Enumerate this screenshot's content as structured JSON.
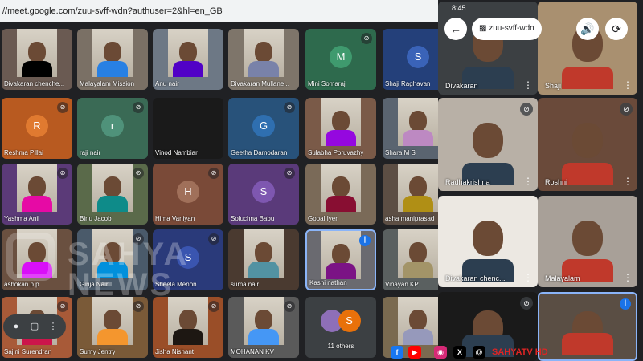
{
  "browser": {
    "url": "//meet.google.com/zuu-svff-wdn?authuser=2&hl=en_GB"
  },
  "grid": {
    "participants": [
      {
        "name": "Divakaran chenche...",
        "kind": "photo",
        "bg": "#6a5a52",
        "mic_off": false
      },
      {
        "name": "Malayalam Mission",
        "kind": "photo",
        "bg": "#7a7065",
        "mic_off": false
      },
      {
        "name": "Anu nair",
        "kind": "photo",
        "bg": "#6d7885",
        "mic_off": false
      },
      {
        "name": "Divakaran Mullane...",
        "kind": "photo",
        "bg": "#7e756a",
        "mic_off": false
      },
      {
        "name": "Mini Somaraj",
        "kind": "avatar",
        "letter": "M",
        "bg": "#2e6a4d",
        "avatar": "#3f9a6e",
        "mic_off": true
      },
      {
        "name": "Shaji Raghavan",
        "kind": "avatar",
        "letter": "S",
        "bg": "#24407a",
        "avatar": "#3a63b8",
        "mic_off": true
      },
      {
        "name": "Reshma Pillai",
        "kind": "avatar",
        "letter": "R",
        "bg": "#b85a20",
        "avatar": "#e07a30",
        "mic_off": true
      },
      {
        "name": "raji nair",
        "kind": "avatar",
        "letter": "r",
        "bg": "#3a6a55",
        "avatar": "#4f927a",
        "mic_off": true
      },
      {
        "name": "Vinod Nambiar",
        "kind": "dark",
        "bg": "#1a1a1a",
        "mic_off": false
      },
      {
        "name": "Geetha Damodaran",
        "kind": "avatar",
        "letter": "G",
        "bg": "#28527a",
        "avatar": "#2f6fb0",
        "mic_off": true
      },
      {
        "name": "Sulabha Poruvazhy",
        "kind": "photo",
        "bg": "#7a5a48",
        "mic_off": false
      },
      {
        "name": "Shara M S",
        "kind": "photo",
        "bg": "#5a6470",
        "mic_off": false
      },
      {
        "name": "Yashma Anil",
        "kind": "photo",
        "bg": "#5b3a78",
        "mic_off": true
      },
      {
        "name": "Binu Jacob",
        "kind": "photo",
        "bg": "#5a6a4a",
        "mic_off": true
      },
      {
        "name": "Hima Vaniyan",
        "kind": "avatar",
        "letter": "H",
        "bg": "#7a4a38",
        "avatar": "#a0705a",
        "mic_off": true
      },
      {
        "name": "Soluchna Babu",
        "kind": "avatar",
        "letter": "S",
        "bg": "#5a3a7a",
        "avatar": "#7e57b0",
        "mic_off": true
      },
      {
        "name": "Gopal Iyer",
        "kind": "photo",
        "bg": "#7a6a58",
        "mic_off": false
      },
      {
        "name": "asha maniprasad",
        "kind": "photo",
        "bg": "#5c4e44",
        "mic_off": false
      },
      {
        "name": "ashokan p p",
        "kind": "photo",
        "bg": "#6a5040",
        "mic_off": false
      },
      {
        "name": "Girija Nair",
        "kind": "photo",
        "bg": "#4a5a6a",
        "mic_off": true
      },
      {
        "name": "Sheela Menon",
        "kind": "avatar",
        "letter": "S",
        "bg": "#2a3a7a",
        "avatar": "#3a55b0",
        "mic_off": true
      },
      {
        "name": "suma nair",
        "kind": "photo",
        "bg": "#4a3a30",
        "mic_off": false
      },
      {
        "name": "Kashi nathan",
        "kind": "photo",
        "bg": "#6a6a70",
        "mic_off": false,
        "speaking": true
      },
      {
        "name": "Vinayan KP",
        "kind": "photo",
        "bg": "#5a6060",
        "mic_off": false
      },
      {
        "name": "Sajini Surendran",
        "kind": "photo",
        "bg": "#a85a38",
        "mic_off": true
      },
      {
        "name": "Sumy Jentry",
        "kind": "photo",
        "bg": "#7a5a38",
        "mic_off": true
      },
      {
        "name": "Jisha Nishant",
        "kind": "photo",
        "bg": "#9a4e28",
        "mic_off": true
      },
      {
        "name": "MOHANAN KV",
        "kind": "photo",
        "bg": "#5a5a5a",
        "mic_off": true
      },
      {
        "name": "11 others",
        "kind": "others",
        "bg": "#3c4043",
        "mic_off": false
      },
      {
        "name": "",
        "kind": "photo",
        "bg": "#7a6a50",
        "mic_off": false
      }
    ]
  },
  "watermark": {
    "line1": "SAHYA",
    "line2": "NEWS"
  },
  "phone": {
    "time": "8:45",
    "room": "zuu-svff-wdn",
    "tiles": [
      {
        "name": "Divakaran",
        "bg": "#3c4043",
        "mic_off": false
      },
      {
        "name": "Shaji",
        "bg": "#a99070",
        "mic_off": false
      },
      {
        "name": "Radhakrishna",
        "bg": "#b8b0a6",
        "mic_off": true
      },
      {
        "name": "Roshni",
        "bg": "#6a4a3a",
        "mic_off": true
      },
      {
        "name": "Divakaran chenc...",
        "bg": "#ece8e2",
        "mic_off": false
      },
      {
        "name": "Malayalam",
        "bg": "#a8a098",
        "mic_off": false
      },
      {
        "name": "",
        "bg": "#1a1a1a",
        "mic_off": true
      },
      {
        "name": "",
        "bg": "#5a4e44",
        "mic_off": false,
        "speaking": true
      }
    ]
  },
  "branding": {
    "tv": "SAHYATV HD"
  },
  "colors": {
    "blue": "#1a73e8",
    "facebook": "#1877f2",
    "youtube": "#ff0000",
    "instagram": "#d62976",
    "brand_red": "#e02424"
  },
  "icons": {
    "mic_off": "mic-off-icon",
    "speaking": "audio-level-icon",
    "back": "back-arrow-icon",
    "speaker": "speaker-icon",
    "switch_camera": "switch-camera-icon"
  }
}
